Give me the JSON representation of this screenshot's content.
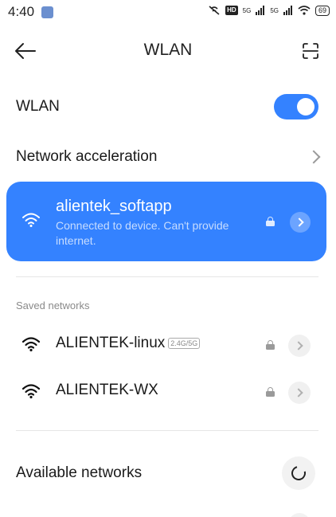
{
  "status_bar": {
    "time": "4:40",
    "hd": "HD",
    "signal_1": "5G",
    "signal_2": "5G",
    "battery": "69"
  },
  "header": {
    "title": "WLAN"
  },
  "wlan_toggle": {
    "label": "WLAN",
    "enabled": true
  },
  "network_acceleration": {
    "label": "Network acceleration"
  },
  "connected_network": {
    "name": "alientek_softapp",
    "status": "Connected to device. Can't provide internet.",
    "secured": true
  },
  "saved_networks": {
    "label": "Saved networks",
    "items": [
      {
        "name": "ALIENTEK-linux",
        "band": "2.4G/5G",
        "secured": true
      },
      {
        "name": "ALIENTEK-WX",
        "band": "",
        "secured": true
      }
    ]
  },
  "available_networks": {
    "label": "Available networks"
  },
  "colors": {
    "accent": "#3482ff",
    "text": "#1a1a1a",
    "secondary_text": "#8a8a8a"
  },
  "icons": [
    "back-arrow-icon",
    "scan-icon",
    "chevron-right-icon",
    "wifi-icon",
    "lock-icon",
    "refresh-icon"
  ]
}
